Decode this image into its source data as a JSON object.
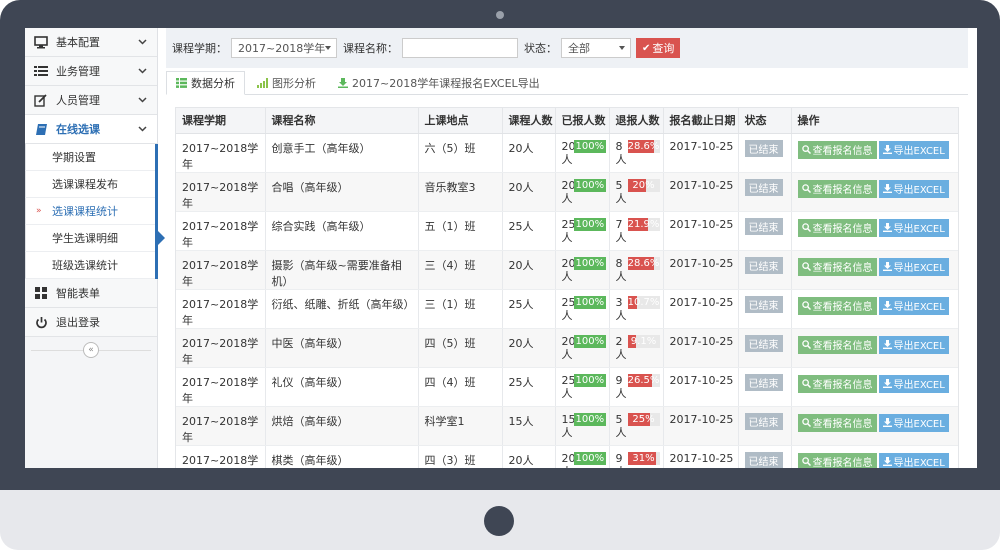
{
  "sidebar": {
    "items": [
      {
        "label": "基本配置",
        "icon": "monitor-icon"
      },
      {
        "label": "业务管理",
        "icon": "list-icon"
      },
      {
        "label": "人员管理",
        "icon": "edit-icon"
      },
      {
        "label": "在线选课",
        "icon": "book-icon"
      }
    ],
    "sub_items": [
      {
        "label": "学期设置"
      },
      {
        "label": "选课课程发布"
      },
      {
        "label": "选课课程统计"
      },
      {
        "label": "学生选课明细"
      },
      {
        "label": "班级选课统计"
      }
    ],
    "bottom_items": [
      {
        "label": "智能表单",
        "icon": "grid-icon"
      },
      {
        "label": "退出登录",
        "icon": "power-icon"
      }
    ],
    "collapse_label": "«"
  },
  "filter": {
    "term_label": "课程学期：",
    "term_value": "2017~2018学年",
    "course_label": "课程名称：",
    "course_value": "",
    "status_label": "状态：",
    "status_value": "全部",
    "query_label": "查询"
  },
  "tabs": [
    {
      "label": "数据分析",
      "icon": "table-icon"
    },
    {
      "label": "图形分析",
      "icon": "bar-chart-icon"
    },
    {
      "label": "2017~2018学年课程报名EXCEL导出",
      "icon": "download-icon"
    }
  ],
  "table": {
    "headers": [
      "课程学期",
      "课程名称",
      "上课地点",
      "课程人数",
      "已报人数",
      "退报人数",
      "报名截止日期",
      "状态",
      "操作"
    ],
    "view_label": "查看报名信息",
    "export_label": "导出EXCEL",
    "rows": [
      {
        "term": "2017~2018学年",
        "name": "创意手工（高年级）",
        "place": "六（5）班",
        "capacity": "20人",
        "signed": "20",
        "signed_unit": "人",
        "signed_pct": "100%",
        "quit": "8",
        "quit_unit": "人",
        "quit_pct": "28.6%",
        "quit_ratio": 0.286,
        "deadline": "2017-10-25",
        "status": "已结束"
      },
      {
        "term": "2017~2018学年",
        "name": "合唱（高年级）",
        "place": "音乐教室3",
        "capacity": "20人",
        "signed": "20",
        "signed_unit": "人",
        "signed_pct": "100%",
        "quit": "5",
        "quit_unit": "人",
        "quit_pct": "20%",
        "quit_ratio": 0.2,
        "deadline": "2017-10-25",
        "status": "已结束"
      },
      {
        "term": "2017~2018学年",
        "name": "综合实践（高年级）",
        "place": "五（1）班",
        "capacity": "25人",
        "signed": "25",
        "signed_unit": "人",
        "signed_pct": "100%",
        "quit": "7",
        "quit_unit": "人",
        "quit_pct": "21.9%",
        "quit_ratio": 0.219,
        "deadline": "2017-10-25",
        "status": "已结束"
      },
      {
        "term": "2017~2018学年",
        "name": "摄影（高年级~需要准备相机）",
        "place": "三（4）班",
        "capacity": "20人",
        "signed": "20",
        "signed_unit": "人",
        "signed_pct": "100%",
        "quit": "8",
        "quit_unit": "人",
        "quit_pct": "28.6%",
        "quit_ratio": 0.286,
        "deadline": "2017-10-25",
        "status": "已结束"
      },
      {
        "term": "2017~2018学年",
        "name": "衍纸、纸雕、折纸（高年级）",
        "place": "三（1）班",
        "capacity": "25人",
        "signed": "25",
        "signed_unit": "人",
        "signed_pct": "100%",
        "quit": "3",
        "quit_unit": "人",
        "quit_pct": "10.7%",
        "quit_ratio": 0.107,
        "deadline": "2017-10-25",
        "status": "已结束"
      },
      {
        "term": "2017~2018学年",
        "name": "中医（高年级）",
        "place": "四（5）班",
        "capacity": "20人",
        "signed": "20",
        "signed_unit": "人",
        "signed_pct": "100%",
        "quit": "2",
        "quit_unit": "人",
        "quit_pct": "9.1%",
        "quit_ratio": 0.091,
        "deadline": "2017-10-25",
        "status": "已结束"
      },
      {
        "term": "2017~2018学年",
        "name": "礼仪（高年级）",
        "place": "四（4）班",
        "capacity": "25人",
        "signed": "25",
        "signed_unit": "人",
        "signed_pct": "100%",
        "quit": "9",
        "quit_unit": "人",
        "quit_pct": "26.5%",
        "quit_ratio": 0.265,
        "deadline": "2017-10-25",
        "status": "已结束"
      },
      {
        "term": "2017~2018学年",
        "name": "烘焙（高年级）",
        "place": "科学室1",
        "capacity": "15人",
        "signed": "15",
        "signed_unit": "人",
        "signed_pct": "100%",
        "quit": "5",
        "quit_unit": "人",
        "quit_pct": "25%",
        "quit_ratio": 0.25,
        "deadline": "2017-10-25",
        "status": "已结束"
      },
      {
        "term": "2017~2018学年",
        "name": "棋类（高年级）",
        "place": "四（3）班",
        "capacity": "20人",
        "signed": "20",
        "signed_unit": "人",
        "signed_pct": "100%",
        "quit": "9",
        "quit_unit": "人",
        "quit_pct": "31%",
        "quit_ratio": 0.31,
        "deadline": "2017-10-25",
        "status": "已结束"
      }
    ]
  },
  "colors": {
    "accent": "#2d6fb4",
    "danger": "#d9534f",
    "success": "#5cb85c",
    "frame": "#3f4654"
  }
}
